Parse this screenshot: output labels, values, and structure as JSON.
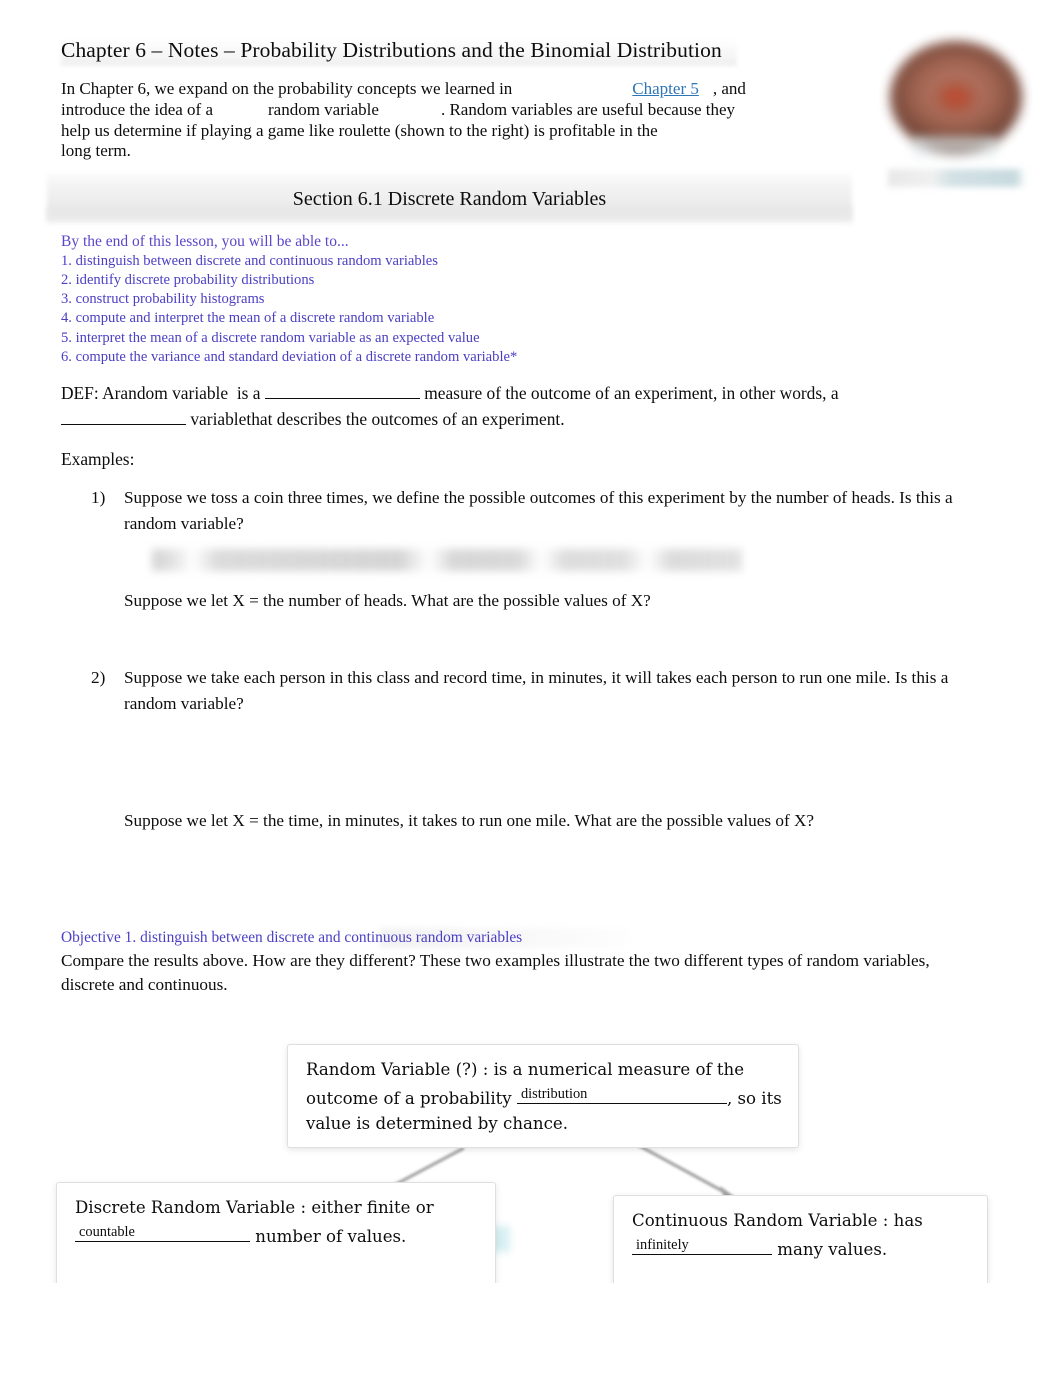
{
  "document": {
    "title": "Chapter 6  – Notes  – Probability Distributions and the Binomial Distribution",
    "intro": {
      "line1_before": "In Chapter 6, we expand on the probability concepts we learned in",
      "link_text": "Chapter 5",
      "line1_after": ", and",
      "line2_a": "introduce the idea of a",
      "line2_b": "random variable",
      "line2_c": ".  Random variables are useful because they",
      "line3": "help us determine if playing a game like roulette (shown to the right) is profitable in the",
      "line4": "long term."
    },
    "figure": {
      "alt": "roulette-wheel-photo",
      "caption": ""
    },
    "section": {
      "heading": "Section 6.1 Discrete Random Variables"
    },
    "objectives": {
      "heading": "By the end of this lesson, you will be able to...",
      "items": [
        "1. distinguish between discrete and continuous random variables",
        "2. identify discrete probability distributions",
        "3. construct probability histograms",
        "4. compute and interpret the mean of a discrete random variable",
        "5. interpret the mean of a discrete random variable as an expected value",
        "6. compute the variance and standard deviation of a discrete random variable*"
      ]
    },
    "definition": {
      "lead": "DEF: A",
      "term": "random variable",
      "mid1": "is a",
      "mid2": "measure of the outcome of an experiment, in other words, a",
      "mid3": "variable",
      "mid4": "that describes the outcomes of an experiment.",
      "blank1": "",
      "blank2": ""
    },
    "examples_label": "Examples:",
    "examples": [
      {
        "number": "1)",
        "prompt": "Suppose we toss a coin three times, we define the possible outcomes of this experiment by the number of heads.   Is this a random variable?",
        "redacted_answer": "",
        "followup": "Suppose we let X = the number of heads.   What are the possible values of X?"
      },
      {
        "number": "2)",
        "prompt": "Suppose we take each person in this class and record time, in minutes, it will takes each person to run one mile.  Is this a random variable?",
        "redacted_answer": "",
        "followup": "Suppose we let X = the time, in minutes, it takes to run one mile.    What are the possible values of X?"
      }
    ],
    "objective1": {
      "heading": "Objective 1. distinguish between discrete and continuous random variables",
      "paragraph": "Compare the results above.   How are they different?   These two examples illustrate the two different types of random variables, discrete and continuous."
    },
    "diagram": {
      "top_box": {
        "title": "Random Variable   (?)",
        "text_a": ": is a numerical measure of the",
        "text_b": "outcome of a probability",
        "fill": "distribution",
        "text_c": ", so its",
        "text_d": "value is determined by chance."
      },
      "left_box": {
        "title": "Discrete Random Variable",
        "text_a": ": either finite or",
        "fill": "countable",
        "text_b": "number of values."
      },
      "right_box": {
        "title": "Continuous Random Variable",
        "text_a": ": has",
        "fill": "infinitely",
        "text_b": "many values."
      }
    },
    "colors": {
      "link": "#2e75b6",
      "objective_text": "#4a3fc4",
      "objective_heading": "#5a46c8",
      "body_text": "#0d0d0d"
    }
  }
}
